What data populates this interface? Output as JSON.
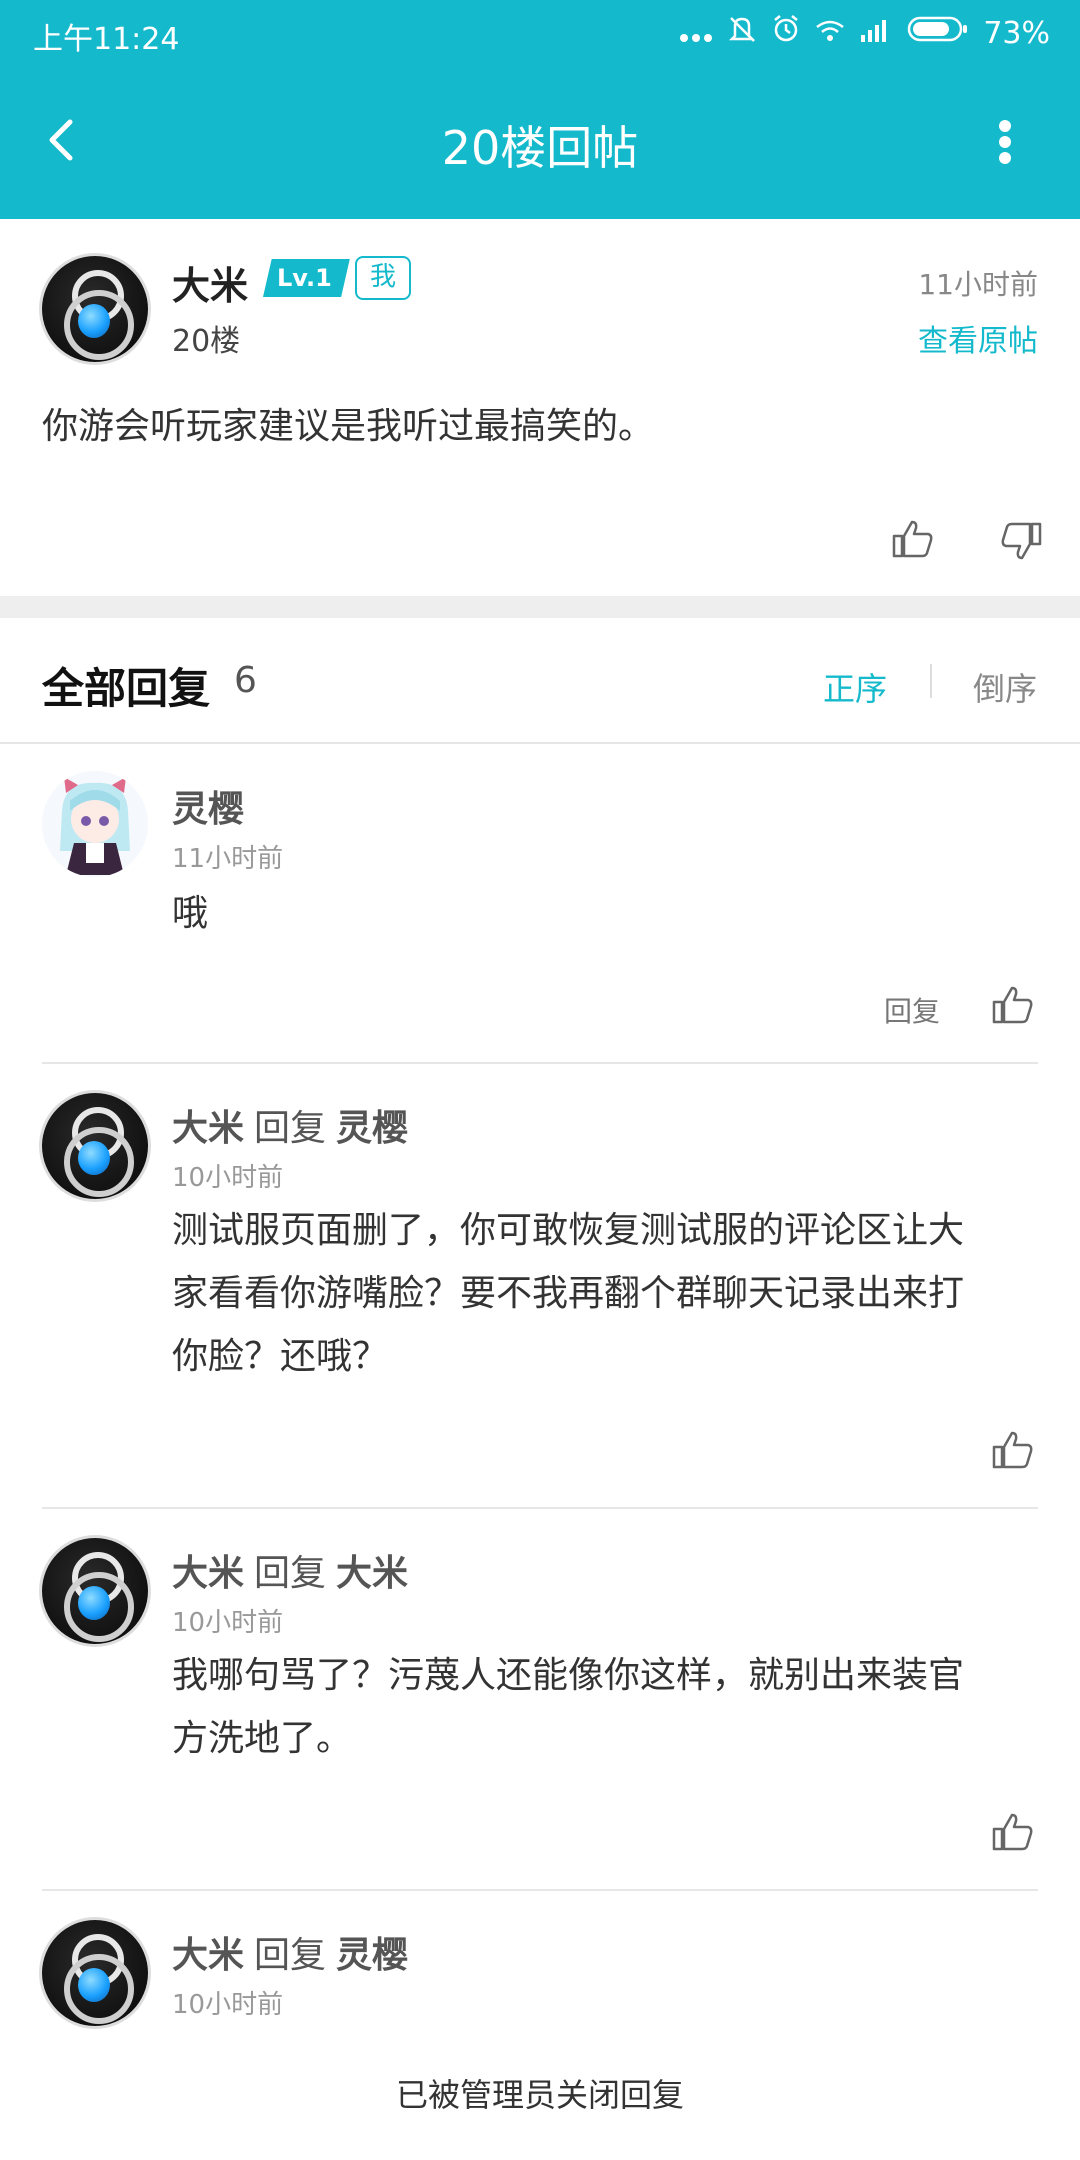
{
  "status": {
    "time": "上午11:24",
    "battery": "73%",
    "icons": [
      "more-dots-icon",
      "mute-icon",
      "alarm-icon",
      "wifi-icon",
      "signal-icon",
      "battery-icon"
    ]
  },
  "appbar": {
    "title": "20楼回帖",
    "back_icon": "back-arrow-icon",
    "more_icon": "more-vertical-icon"
  },
  "post": {
    "username": "大米",
    "level": "Lv.1",
    "me_tag": "我",
    "floor": "20楼",
    "time": "11小时前",
    "view_original": "查看原帖",
    "content": "你游会听玩家建议是我听过最搞笑的。"
  },
  "replies_header": {
    "title": "全部回复",
    "count": "6",
    "sort_asc": "正序",
    "sort_desc": "倒序"
  },
  "replies": [
    {
      "user": "灵樱",
      "time": "11小时前",
      "text": "哦",
      "reply_label": "回复"
    },
    {
      "user": "大米",
      "action": "回复",
      "target": "灵樱",
      "time": "10小时前",
      "lines": [
        "测试服页面删了，你可敢恢复测试服的评论区让大",
        "家看看你游嘴脸？要不我再翻个群聊天记录出来打",
        "你脸？还哦？"
      ]
    },
    {
      "user": "大米",
      "action": "回复",
      "target": "大米",
      "time": "10小时前",
      "lines": [
        "我哪句骂了？污蔑人还能像你这样，就别出来装官",
        "方洗地了。"
      ]
    },
    {
      "user": "大米",
      "action": "回复",
      "target": "灵樱",
      "time": "10小时前"
    }
  ],
  "footer": {
    "closed_text": "已被管理员关闭回复"
  },
  "colors": {
    "accent": "#14BACC",
    "divider": "#eeeeee"
  }
}
